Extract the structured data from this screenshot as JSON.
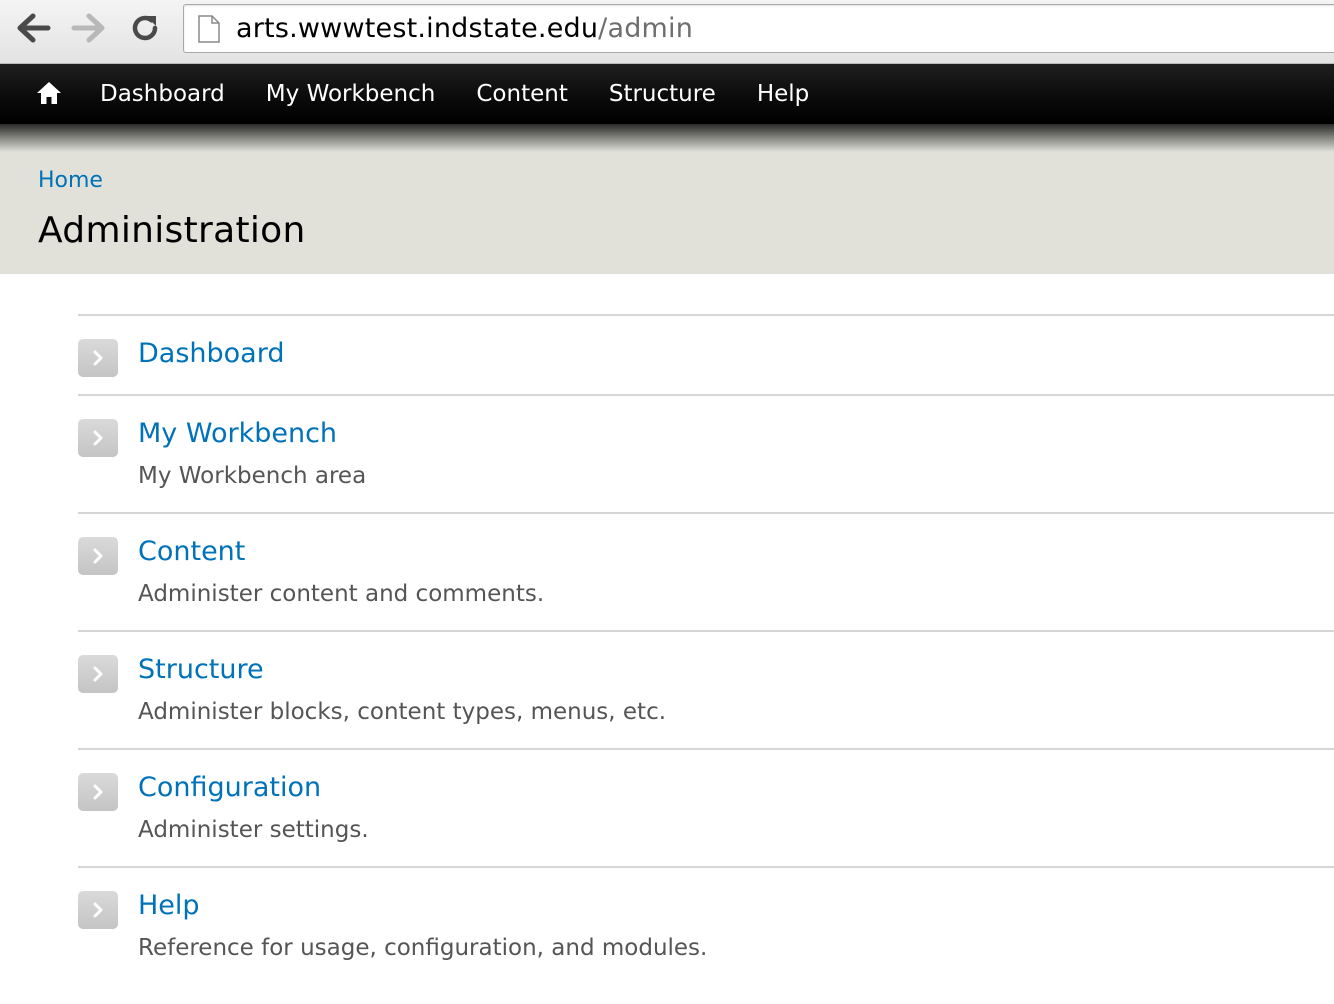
{
  "browser": {
    "back_icon": "back-arrow-icon",
    "forward_icon": "forward-arrow-icon",
    "reload_icon": "reload-icon",
    "page_icon": "page-icon",
    "url_host": "arts.wwwtest.indstate.edu",
    "url_path": "/admin"
  },
  "toolbar": {
    "home_icon": "home-icon",
    "items": [
      {
        "label": "Dashboard"
      },
      {
        "label": "My Workbench"
      },
      {
        "label": "Content"
      },
      {
        "label": "Structure"
      },
      {
        "label": "Help"
      }
    ]
  },
  "header": {
    "breadcrumb": "Home",
    "title": "Administration"
  },
  "admin_list": {
    "arrow_icon": "chevron-right-icon",
    "items": [
      {
        "title": "Dashboard",
        "description": ""
      },
      {
        "title": "My Workbench",
        "description": "My Workbench area"
      },
      {
        "title": "Content",
        "description": "Administer content and comments."
      },
      {
        "title": "Structure",
        "description": "Administer blocks, content types, menus, etc."
      },
      {
        "title": "Configuration",
        "description": "Administer settings."
      },
      {
        "title": "Help",
        "description": "Reference for usage, configuration, and modules."
      }
    ]
  },
  "colors": {
    "link": "#0072b9",
    "toolbar_bg": "#000000",
    "header_bg": "#e1e1da",
    "description_text": "#555555",
    "divider": "#d6d6d6"
  }
}
